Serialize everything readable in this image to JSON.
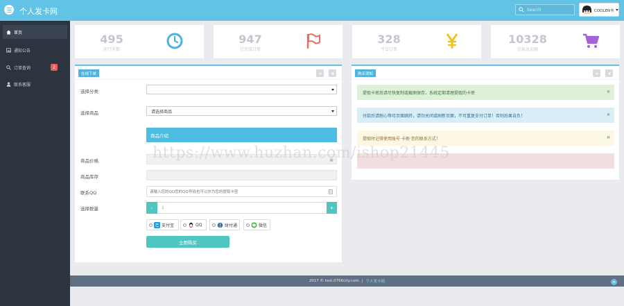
{
  "header": {
    "site_title": "个人发卡网",
    "search_placeholder": "Search",
    "user_name": "COOLEN卡"
  },
  "sidebar": {
    "items": [
      {
        "label": "首页",
        "icon": "home-icon",
        "active": true
      },
      {
        "label": "通知公告",
        "icon": "image-icon"
      },
      {
        "label": "订单查询",
        "icon": "search-icon",
        "badge": "2"
      },
      {
        "label": "联系客服",
        "icon": "user-icon"
      }
    ]
  },
  "stats": [
    {
      "value": "495",
      "label": "运行天数",
      "icon": "clock-icon",
      "color": "#4ab3e3"
    },
    {
      "value": "947",
      "label": "已完成订单",
      "icon": "flag-icon",
      "color": "#ef6b5c"
    },
    {
      "value": "328",
      "label": "今日订单",
      "icon": "yen-icon",
      "color": "#f2c21f"
    },
    {
      "value": "10328",
      "label": "交易总金额",
      "icon": "cart-icon",
      "color": "#a363d9"
    }
  ],
  "order_panel": {
    "title": "在线下单",
    "labels": {
      "category": "选择分类",
      "product": "选择商品",
      "price": "商品价格",
      "stock": "商品库存",
      "contact": "联系QQ",
      "quantity": "选择数量"
    },
    "category_value": "",
    "product_value": "请选择商品",
    "intro_label": "商品介绍",
    "qq_placeholder": "请输入您的QQ您的QQ号码也可以作为您的提取卡密",
    "quantity_value": "1",
    "minus_label": "-",
    "plus_label": "+",
    "payments": [
      {
        "label": "支付宝",
        "icon": "alipay-icon"
      },
      {
        "label": "QQ",
        "icon": "qq-icon"
      },
      {
        "label": "财付通",
        "icon": "tenpay-icon"
      },
      {
        "label": "微信",
        "icon": "wechat-icon"
      }
    ],
    "submit_label": "立即购买"
  },
  "notice_panel": {
    "title": "购买须知",
    "alerts": [
      {
        "text": "提取卡密后请尽快复制或截图保存，系统定期清理提取的卡密",
        "bg": "#dff0d8",
        "color": "#3c763d"
      },
      {
        "text": "付款后请耐心等待页面跳转，请勿关闭或刷新页面，不可重复支付订单！否则后果自负！",
        "bg": "#d9edf7",
        "color": "#31708f"
      },
      {
        "text": "提取时记得使用账号·卡密·您的联系方式！",
        "bg": "#fcf8e3",
        "color": "#8a6d3b"
      },
      {
        "text": "",
        "bg": "#f2dede",
        "color": "#a94442"
      }
    ],
    "close_symbol": "✖"
  },
  "footer": {
    "copyright": "2017 © test.0766city.com",
    "separator": "|",
    "link": "个人发卡网"
  },
  "watermark": "https://www.huzhan.com/ishop21445",
  "colors": {
    "topbar": "#62c3e6",
    "sidebar": "#2c3440",
    "accent_teal": "#4fc7c0"
  }
}
